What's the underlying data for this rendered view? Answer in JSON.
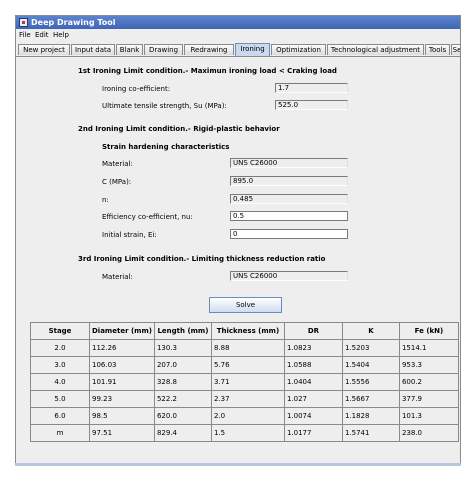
{
  "window": {
    "title": "Deep Drawing Tool"
  },
  "menu": [
    "File",
    "Edit",
    "Help"
  ],
  "tabs": [
    "New project",
    "Input data",
    "Blank",
    "Drawing",
    "Redrawing",
    "Ironing",
    "Optimization",
    "Technological adjustment",
    "Tools",
    "Se"
  ],
  "active_tab": "Ironing",
  "section1": {
    "heading": "1st Ironing Limit condition.- Maximun ironing load < Craking load",
    "rows": [
      {
        "label": "Ironing co-efficient:",
        "value": "1.7"
      },
      {
        "label": "Ultimate tensile strength, Su (MPa):",
        "value": "525.0"
      }
    ]
  },
  "section2": {
    "heading": "2nd Ironing Limit condition.- Rigid-plastic behavior",
    "subheading": "Strain hardening characteristics",
    "rows": [
      {
        "label": "Material:",
        "value": "UNS C26000"
      },
      {
        "label": "C (MPa):",
        "value": "895.0"
      },
      {
        "label": "n:",
        "value": "0.485"
      },
      {
        "label": "Efficiency co-efficient, nu:",
        "value": "0.5"
      },
      {
        "label": "Initial strain, Ei:",
        "value": "0"
      }
    ]
  },
  "section3": {
    "heading": "3rd  Ironing Limit condition.- Limiting thickness reduction ratio",
    "rows": [
      {
        "label": "Material:",
        "value": "UNS C26000"
      }
    ]
  },
  "solve_label": "Solve",
  "table": {
    "headers": [
      "Stage",
      "Diameter (mm)",
      "Length (mm)",
      "Thickness (mm)",
      "DR",
      "K",
      "Fe (kN)"
    ],
    "rows": [
      [
        "2.0",
        "112.26",
        "130.3",
        "8.88",
        "1.0823",
        "1.5203",
        "1514.1"
      ],
      [
        "3.0",
        "106.03",
        "207.0",
        "5.76",
        "1.0588",
        "1.5404",
        "953.3"
      ],
      [
        "4.0",
        "101.91",
        "328.8",
        "3.71",
        "1.0404",
        "1.5556",
        "600.2"
      ],
      [
        "5.0",
        "99.23",
        "522.2",
        "2.37",
        "1.027",
        "1.5667",
        "377.9"
      ],
      [
        "6.0",
        "98.5",
        "620.0",
        "2.0",
        "1.0074",
        "1.1828",
        "101.3"
      ],
      [
        "m",
        "97.51",
        "829.4",
        "1.5",
        "1.0177",
        "1.5741",
        "238.0"
      ]
    ]
  }
}
